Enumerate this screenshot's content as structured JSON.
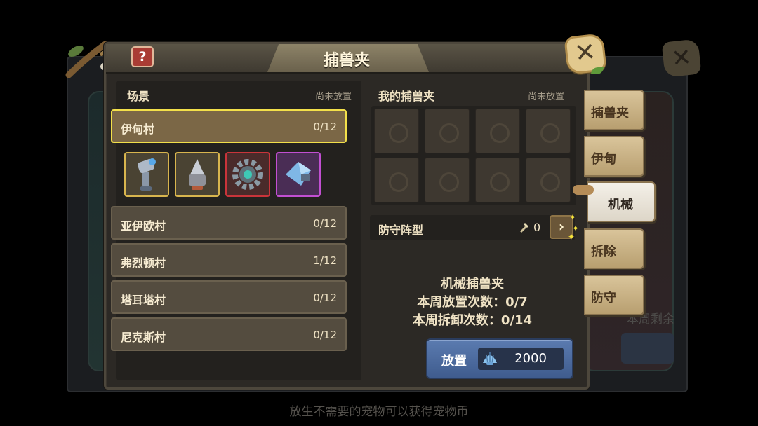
{
  "dialog": {
    "title": "捕兽夹",
    "help_label": "?",
    "close_label": "✕"
  },
  "scene_panel": {
    "title": "场景",
    "status": "尚未放置",
    "scenes": [
      {
        "name": "伊甸村",
        "count": "0/12",
        "selected": true
      },
      {
        "name": "亚伊欧村",
        "count": "0/12"
      },
      {
        "name": "弗烈顿村",
        "count": "1/12"
      },
      {
        "name": "塔耳塔村",
        "count": "0/12"
      },
      {
        "name": "尼克斯村",
        "count": "0/12"
      }
    ],
    "rewards": [
      {
        "icon": "hammer-icon",
        "rarity_color": "#d8b54e"
      },
      {
        "icon": "drill-icon",
        "rarity_color": "#d8b54e"
      },
      {
        "icon": "gear-icon",
        "rarity_color": "#c9343a"
      },
      {
        "icon": "crystal-icon",
        "rarity_color": "#c24fd2"
      }
    ]
  },
  "trap_panel": {
    "title": "我的捕兽夹",
    "status": "尚未放置",
    "slots": [
      "empty-trap-slot",
      "empty-trap-slot",
      "empty-trap-slot",
      "empty-trap-slot",
      "empty-trap-slot",
      "empty-trap-slot",
      "empty-trap-slot",
      "empty-trap-slot"
    ]
  },
  "formation": {
    "label": "防守阵型",
    "count": "0",
    "arrow": "›"
  },
  "trap_info": {
    "name": "机械捕兽夹",
    "weekly_place": "本周放置次数：0/7",
    "weekly_remove": "本周拆卸次数：0/14"
  },
  "place_button": {
    "label": "放置",
    "cost": "2000",
    "cost_icon": "shell-currency-icon"
  },
  "side_tabs": [
    {
      "label": "捕兽夹"
    },
    {
      "label": "伊甸"
    },
    {
      "label": "机械",
      "active": true
    },
    {
      "label": "拆除"
    },
    {
      "label": "防守"
    }
  ],
  "background": {
    "hint": "放生不需要的宠物可以获得宠物币",
    "right_card_text": "本周剩余"
  },
  "colors": {
    "selected_border": "#f3e04a",
    "panel_bg": "#2c2925",
    "place_button": "#4e6ea2"
  }
}
